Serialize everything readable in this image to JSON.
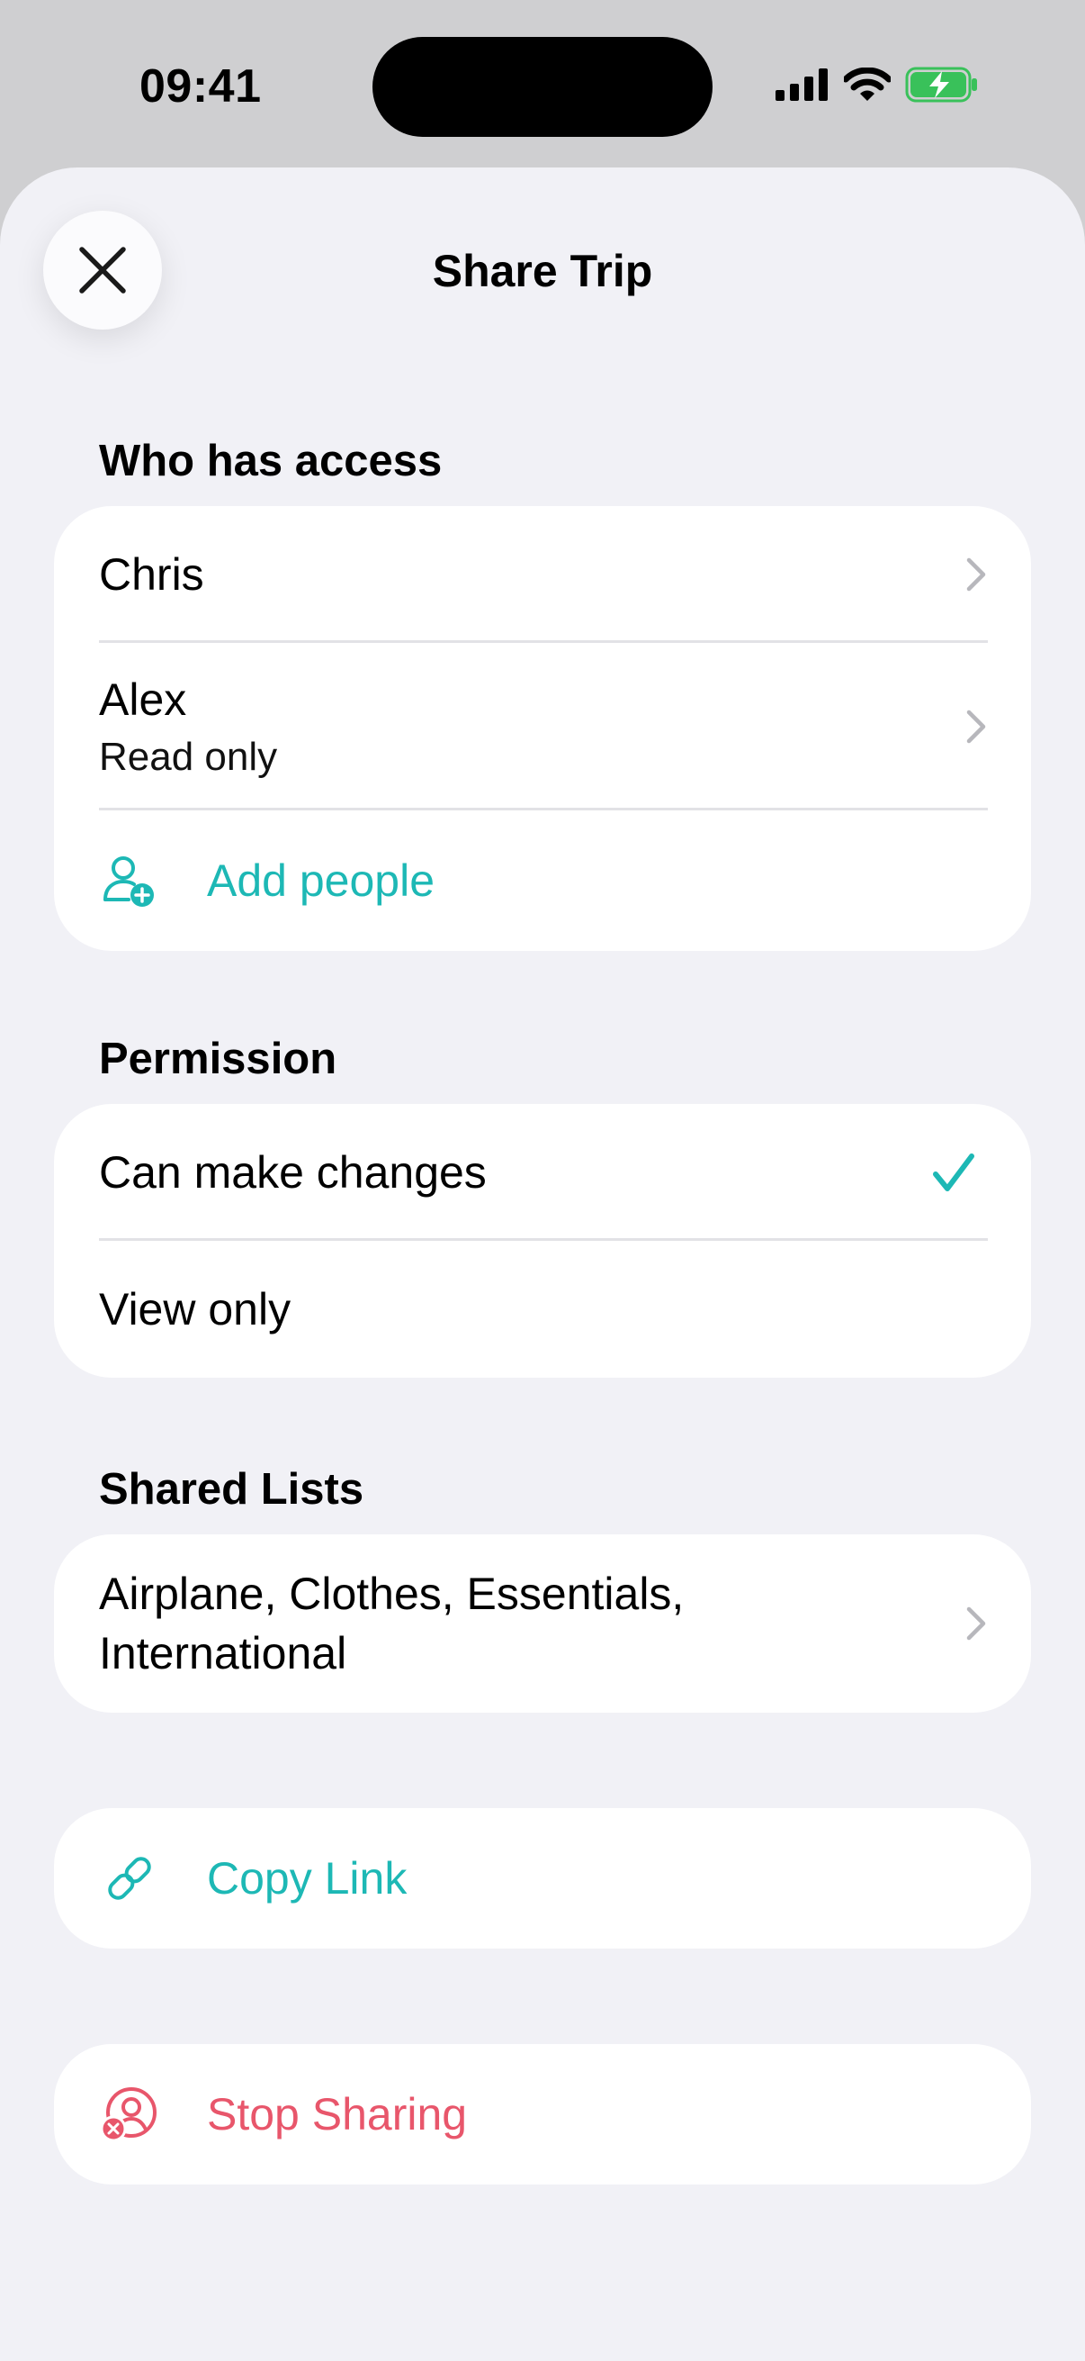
{
  "status_bar": {
    "time": "09:41"
  },
  "header": {
    "title": "Share Trip",
    "close_icon": "close-icon"
  },
  "access": {
    "header": "Who has access",
    "people": [
      {
        "name": "Chris"
      },
      {
        "name": "Alex",
        "role": "Read only"
      }
    ],
    "add_people_label": "Add people"
  },
  "permission": {
    "header": "Permission",
    "options": [
      {
        "label": "Can make changes",
        "selected": true
      },
      {
        "label": "View only",
        "selected": false
      }
    ]
  },
  "shared_lists": {
    "header": "Shared Lists",
    "lists_line1": "Airplane, Clothes, Essentials,",
    "lists_line2": "International"
  },
  "copy_link": {
    "label": "Copy Link"
  },
  "stop_sharing": {
    "label": "Stop Sharing"
  },
  "colors": {
    "accent": "#1db8b5",
    "destructive": "#e8566b",
    "sheet_bg": "#f1f1f6",
    "battery": "#39c15a"
  }
}
